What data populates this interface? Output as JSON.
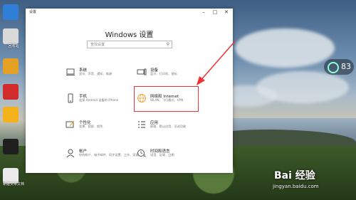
{
  "window": {
    "title": "设置",
    "heading": "Windows 设置",
    "search_placeholder": "查找设置"
  },
  "tiles": [
    {
      "title": "系统",
      "subtitle": "显示、声音、通知、电源",
      "icon": "laptop-icon"
    },
    {
      "title": "设备",
      "subtitle": "蓝牙、打印机、鼠标",
      "icon": "keyboard-icon"
    },
    {
      "title": "手机",
      "subtitle": "连接 Android 设备和 iPhone",
      "icon": "phone-icon"
    },
    {
      "title": "网络和 Internet",
      "subtitle": "WLAN、飞行模式、VPN",
      "icon": "globe-icon"
    },
    {
      "title": "个性化",
      "subtitle": "背景、锁屏、颜色",
      "icon": "paint-icon"
    },
    {
      "title": "应用",
      "subtitle": "卸载、默认应用、可选功能",
      "icon": "apps-icon"
    },
    {
      "title": "帐户",
      "subtitle": "你的帐户、电子邮件、同步设置、工作、家庭",
      "icon": "person-icon"
    },
    {
      "title": "时间和语言",
      "subtitle": "语音、区域、日期",
      "icon": "clock-language-icon"
    }
  ],
  "widget": {
    "value": "83"
  },
  "watermark": {
    "brand": "Bai 经验",
    "url": "jingyan.baidu.com"
  },
  "desktop_labels": [
    "回收站",
    "新建文本文档"
  ],
  "colors": {
    "accent": "#e8a23a",
    "highlight": "#e33333"
  }
}
